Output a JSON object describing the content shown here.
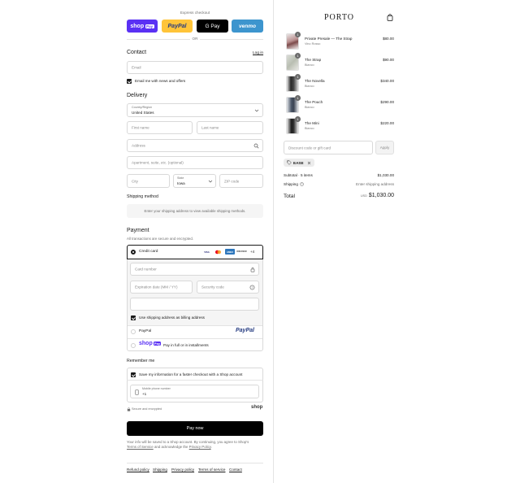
{
  "express": {
    "heading": "Express checkout",
    "shop_pay": {
      "label": "shop",
      "badge": "Pay"
    },
    "paypal": "PayPal",
    "gpay": "G Pay",
    "venmo": "venmo",
    "or": "OR"
  },
  "contact": {
    "title": "Contact",
    "login": "Log in",
    "email_placeholder": "Email",
    "news_label": "Email me with news and offers"
  },
  "delivery": {
    "title": "Delivery",
    "country_label": "Country/Region",
    "country_value": "United States",
    "first_name": "First name",
    "last_name": "Last name",
    "address": "Address",
    "apartment": "Apartment, suite, etc. (optional)",
    "city": "City",
    "state_label": "State",
    "state_value": "Iowa",
    "zip": "ZIP code"
  },
  "shipping_method": {
    "title": "Shipping method",
    "notice": "Enter your shipping address to view available shipping methods."
  },
  "payment": {
    "title": "Payment",
    "subtitle": "All transactions are secure and encrypted.",
    "credit_card": "Credit card",
    "card_icons": [
      "VISA",
      "MC",
      "AMEX",
      "DISCOVER"
    ],
    "more_cards": "+4",
    "card_number": "Card number",
    "expiration": "Expiration date (MM / YY)",
    "security_code": "Security code",
    "name_on_card": "",
    "billing_label": "Use shipping address as billing address",
    "paypal_label": "PayPal",
    "paypal_logo": "PayPal",
    "shoppay_logo": "shop",
    "shoppay_badge": "Pay",
    "shoppay_label": "Pay in full or in installments"
  },
  "remember": {
    "title": "Remember me",
    "save_label": "Save my information for a faster checkout with a Shop account",
    "phone_label": "Mobile phone number",
    "phone_value": "+1",
    "secure_label": "Secure and encrypted",
    "shop_logo": "shop"
  },
  "pay_now": "Pay now",
  "legal": {
    "line1": "Your info will be saved to a Shop account. By continuing, you agree to Shop's",
    "terms": "Terms of Service",
    "middle": "and acknowledge the",
    "privacy": "Privacy Policy",
    "end": "."
  },
  "footer": [
    "Refund policy",
    "Shipping",
    "Privacy policy",
    "Terms of service",
    "Contact"
  ],
  "store": {
    "name": "PORTO",
    "cart_icon": "bag-icon"
  },
  "items": [
    {
      "name": "Private Presale — The Strap",
      "variant": "Vino Rosso",
      "price": "$80.00",
      "qty": "1"
    },
    {
      "name": "The Strap",
      "variant": "Bianco",
      "price": "$90.00",
      "qty": "1"
    },
    {
      "name": "The Novella",
      "variant": "Bianco",
      "price": "$340.00",
      "qty": "1"
    },
    {
      "name": "The Pouch",
      "variant": "Bianco",
      "price": "$290.00",
      "qty": "1"
    },
    {
      "name": "The Mini",
      "variant": "Bianco",
      "price": "$220.00",
      "qty": "1"
    }
  ],
  "discount": {
    "placeholder": "Discount code or gift card",
    "apply": "Apply",
    "code": "EASE"
  },
  "summary": {
    "subtotal_label": "Subtotal · 5 items",
    "subtotal_value": "$1,030.00",
    "shipping_label": "Shipping",
    "shipping_value": "Enter shipping address",
    "total_label": "Total",
    "currency": "USD",
    "total_value": "$1,030.00"
  },
  "colors": {
    "shop_purple": "#5a31f4",
    "paypal_yellow": "#ffc439",
    "venmo_blue": "#3d95ce",
    "black": "#000000"
  }
}
